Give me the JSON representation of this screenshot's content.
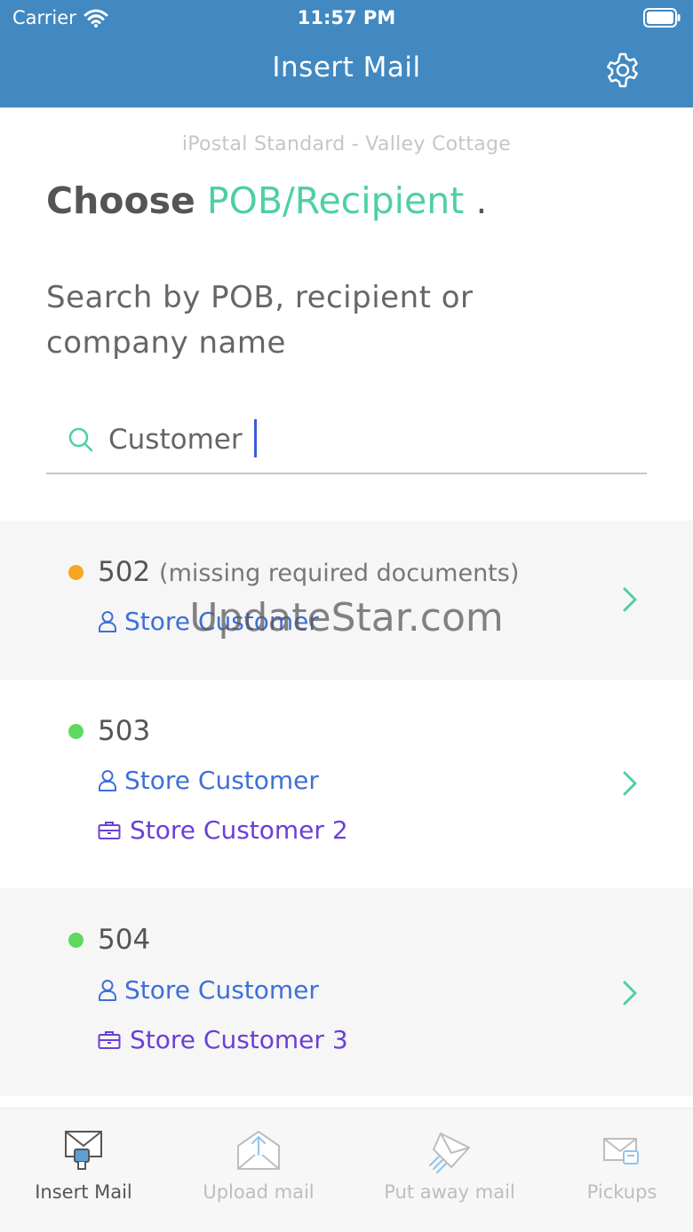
{
  "status_bar": {
    "carrier": "Carrier",
    "time": "11:57 PM"
  },
  "header": {
    "title": "Insert Mail"
  },
  "page": {
    "location": "iPostal Standard - Valley Cottage",
    "heading_prefix": "Choose",
    "heading_highlight": "POB/Recipient",
    "heading_suffix": ".",
    "prompt": "Search by POB, recipient  or company name"
  },
  "search": {
    "value": "Customer",
    "placeholder": ""
  },
  "results": [
    {
      "pob": "502",
      "note": "(missing required documents)",
      "status_color": "#f5a623",
      "recipient": "Store Customer",
      "company": ""
    },
    {
      "pob": "503",
      "note": "",
      "status_color": "#5ed85e",
      "recipient": "Store Customer",
      "company": "Store Customer 2"
    },
    {
      "pob": "504",
      "note": "",
      "status_color": "#5ed85e",
      "recipient": "Store Customer",
      "company": "Store Customer 3"
    }
  ],
  "watermark": "UpdateStar.com",
  "tabs": [
    {
      "label": "Insert Mail",
      "icon": "insert-mail-icon",
      "active": true
    },
    {
      "label": "Upload mail",
      "icon": "upload-mail-icon",
      "active": false
    },
    {
      "label": "Put away mail",
      "icon": "put-away-mail-icon",
      "active": false
    },
    {
      "label": "Pickups",
      "icon": "pickups-icon",
      "active": false
    }
  ],
  "colors": {
    "header": "#4189c0",
    "accent": "#4ecfa6",
    "recipient": "#3f6fd8",
    "company": "#6a3fd8",
    "pending": "#f5a623",
    "ok": "#5ed85e"
  }
}
